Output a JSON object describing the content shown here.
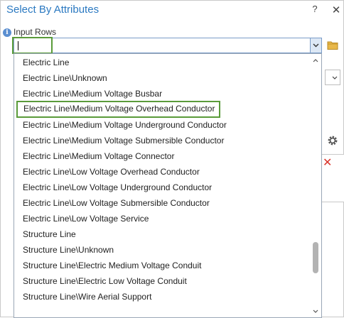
{
  "window": {
    "title": "Select By Attributes",
    "help_label": "?",
    "close_label": "✕"
  },
  "form": {
    "input_rows_label": "Input Rows",
    "input_rows_value": ""
  },
  "dropdown": {
    "items": [
      "Electric Line",
      "Electric Line\\Unknown",
      "Electric Line\\Medium Voltage Busbar",
      "Electric Line\\Medium Voltage Overhead Conductor",
      "Electric Line\\Medium Voltage Underground Conductor",
      "Electric Line\\Medium Voltage Submersible Conductor",
      "Electric Line\\Medium Voltage Connector",
      "Electric Line\\Low Voltage Overhead Conductor",
      "Electric Line\\Low Voltage Underground Conductor",
      "Electric Line\\Low Voltage Submersible Conductor",
      "Electric Line\\Low Voltage Service",
      "Structure Line",
      "Structure Line\\Unknown",
      "Structure Line\\Electric Medium Voltage Conduit",
      "Structure Line\\Electric Low Voltage Conduit",
      "Structure Line\\Wire Aerial Support"
    ],
    "highlighted_item": "Electric Line\\Medium Voltage Overhead Conductor",
    "scroll_position_fraction": 0.85
  },
  "icons": {
    "info": "info-icon",
    "folder": "folder-icon",
    "gear": "gear-icon",
    "remove": "remove-icon"
  },
  "colors": {
    "title": "#2b79c1",
    "highlight_outline": "#5a9b3a",
    "remove": "#d9342b"
  }
}
